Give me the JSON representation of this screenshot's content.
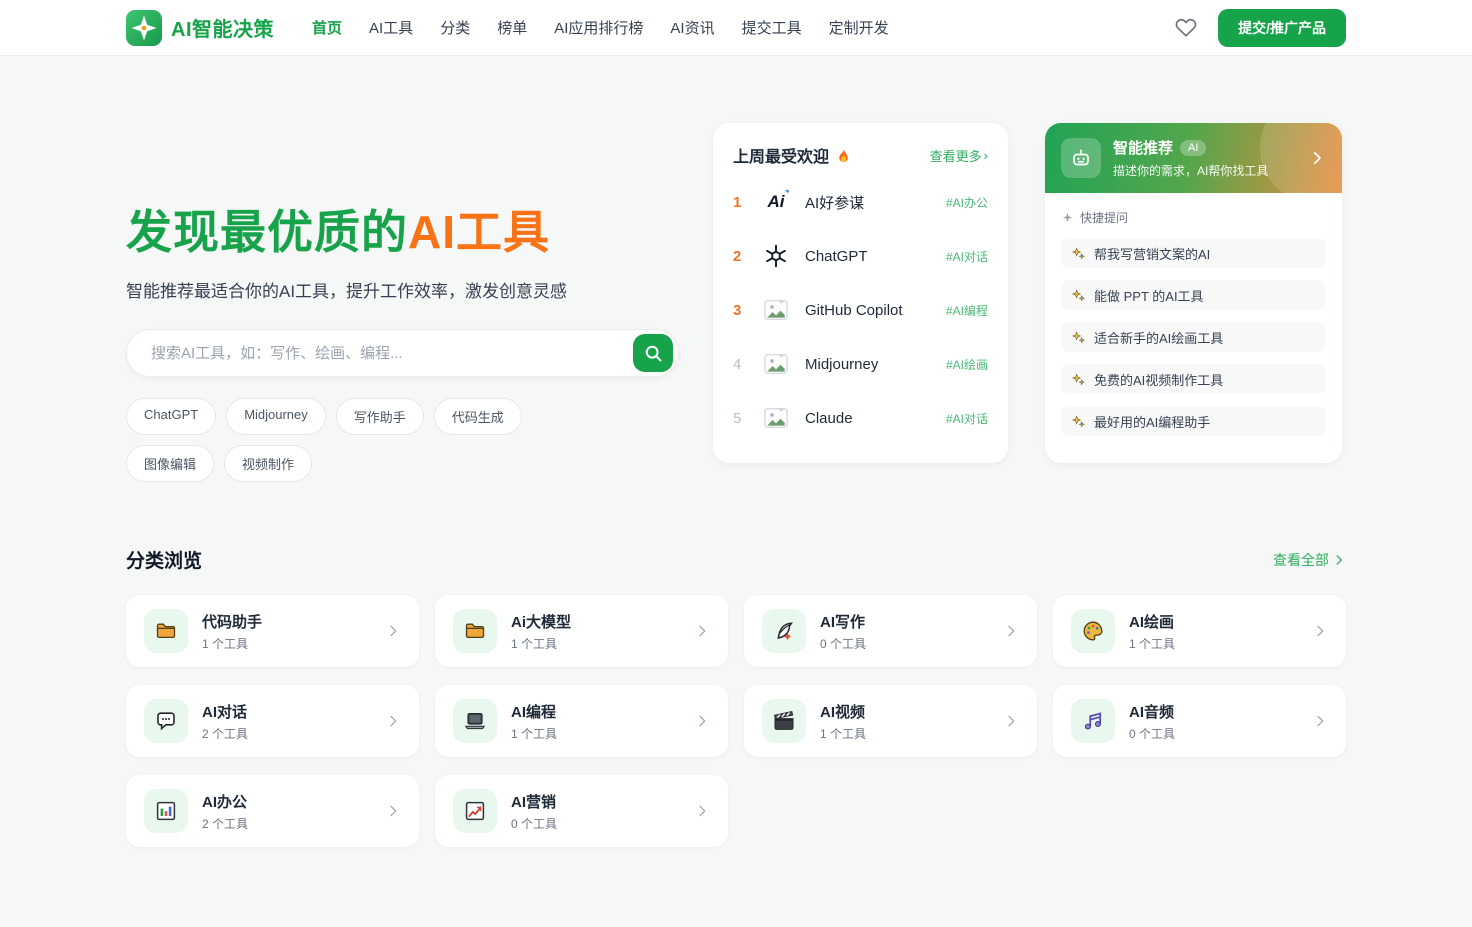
{
  "colors": {
    "primary_green": "#16a34a",
    "accent_orange": "#f97316",
    "tag_green": "#4cb877"
  },
  "brand": {
    "name": "AI智能决策",
    "logo_icon": "compass-star-icon"
  },
  "nav": {
    "items": [
      "首页",
      "AI工具",
      "分类",
      "榜单",
      "AI应用排行榜",
      "AI资讯",
      "提交工具",
      "定制开发"
    ],
    "active": "首页",
    "favorite_icon": "heart-icon",
    "submit_button": "提交/推广产品"
  },
  "hero": {
    "title_green": "发现最优质的",
    "title_orange": "AI工具",
    "subtitle": "智能推荐最适合你的AI工具，提升工作效率，激发创意灵感",
    "search_placeholder": "搜索AI工具，如：写作、绘画、编程...",
    "search_icon": "search-icon",
    "tags": [
      "ChatGPT",
      "Midjourney",
      "写作助手",
      "代码生成",
      "图像编辑",
      "视频制作"
    ]
  },
  "popular": {
    "title": "上周最受欢迎",
    "title_icon": "flame-icon",
    "more_link": "查看更多",
    "more_arrow": "›",
    "items": [
      {
        "rank": "1",
        "name": "AI好参谋",
        "tag": "#AI办公",
        "logo": "ai-text-logo",
        "logo_text": "Ai",
        "logo_spark": "✦"
      },
      {
        "rank": "2",
        "name": "ChatGPT",
        "tag": "#AI对话",
        "logo": "openai-icon"
      },
      {
        "rank": "3",
        "name": "GitHub Copilot",
        "tag": "#AI编程",
        "logo": "broken-image-icon"
      },
      {
        "rank": "4",
        "name": "Midjourney",
        "tag": "#AI绘画",
        "logo": "broken-image-icon"
      },
      {
        "rank": "5",
        "name": "Claude",
        "tag": "#AI对话",
        "logo": "broken-image-icon"
      }
    ]
  },
  "recommend": {
    "title": "智能推荐",
    "badge": "AI",
    "subtitle": "描述你的需求，AI帮你找工具",
    "header_icon": "robot-icon",
    "chevron": "›",
    "quick_label": "快捷提问",
    "quick_label_icon": "sparkle-icon",
    "questions": [
      "帮我写营销文案的AI",
      "能做 PPT 的AI工具",
      "适合新手的AI绘画工具",
      "免费的AI视频制作工具",
      "最好用的AI编程助手"
    ]
  },
  "categories": {
    "title": "分类浏览",
    "view_all": "查看全部",
    "view_all_arrow": "›",
    "items": [
      {
        "name": "代码助手",
        "count": "1 个工具",
        "icon": "folder-icon"
      },
      {
        "name": "Ai大模型",
        "count": "1 个工具",
        "icon": "folder-icon"
      },
      {
        "name": "AI写作",
        "count": "0 个工具",
        "icon": "quill-icon"
      },
      {
        "name": "AI绘画",
        "count": "1 个工具",
        "icon": "palette-icon"
      },
      {
        "name": "AI对话",
        "count": "2 个工具",
        "icon": "speech-bubble-icon"
      },
      {
        "name": "AI编程",
        "count": "1 个工具",
        "icon": "laptop-icon"
      },
      {
        "name": "AI视频",
        "count": "1 个工具",
        "icon": "clapperboard-icon"
      },
      {
        "name": "AI音频",
        "count": "0 个工具",
        "icon": "music-notes-icon"
      },
      {
        "name": "AI办公",
        "count": "2 个工具",
        "icon": "bar-chart-icon"
      },
      {
        "name": "AI营销",
        "count": "0 个工具",
        "icon": "line-chart-icon"
      }
    ]
  }
}
